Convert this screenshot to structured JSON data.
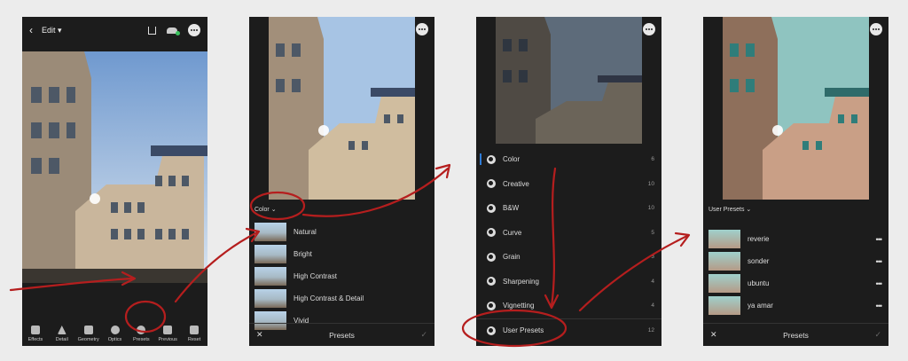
{
  "colors": {
    "accent": "#2e7bd6",
    "annotation": "#b51e1e"
  },
  "panel1": {
    "topbar": {
      "edit_label": "Edit"
    },
    "toolbar": [
      {
        "label": "Effects",
        "icon": "effects-icon"
      },
      {
        "label": "Detail",
        "icon": "detail-icon"
      },
      {
        "label": "Geometry",
        "icon": "geometry-icon"
      },
      {
        "label": "Optics",
        "icon": "optics-icon"
      },
      {
        "label": "Presets",
        "icon": "presets-icon"
      },
      {
        "label": "Previous",
        "icon": "previous-icon"
      },
      {
        "label": "Reset",
        "icon": "reset-icon"
      }
    ]
  },
  "panel2": {
    "category": "Color",
    "presets": [
      "Natural",
      "Bright",
      "High Contrast",
      "High Contrast & Detail",
      "Vivid"
    ],
    "bottom_title": "Presets"
  },
  "panel3": {
    "categories": [
      {
        "label": "Color",
        "count": "6"
      },
      {
        "label": "Creative",
        "count": "10"
      },
      {
        "label": "B&W",
        "count": "10"
      },
      {
        "label": "Curve",
        "count": "5"
      },
      {
        "label": "Grain",
        "count": "3"
      },
      {
        "label": "Sharpening",
        "count": "4"
      },
      {
        "label": "Vignetting",
        "count": "4"
      },
      {
        "label": "User Presets",
        "count": "12"
      }
    ]
  },
  "panel4": {
    "category": "User Presets",
    "presets": [
      "reverie",
      "sonder",
      "ubuntu",
      "ya amar"
    ],
    "bottom_title": "Presets"
  }
}
